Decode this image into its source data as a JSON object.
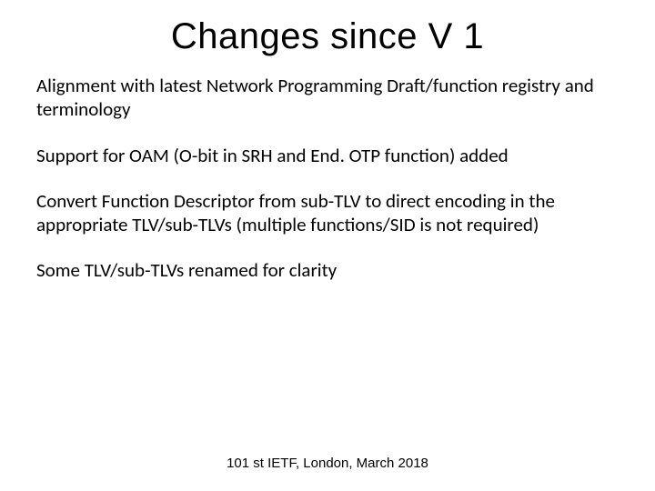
{
  "slide": {
    "title": "Changes since V 1",
    "paragraphs": [
      "Alignment with latest Network Programming Draft/function registry and terminology",
      "Support for OAM (O-bit in SRH and End. OTP function) added",
      "Convert Function Descriptor from sub-TLV to direct encoding in the appropriate TLV/sub-TLVs (multiple functions/SID is not required)",
      "Some TLV/sub-TLVs renamed for clarity"
    ],
    "footer": "101 st IETF, London, March 2018"
  }
}
